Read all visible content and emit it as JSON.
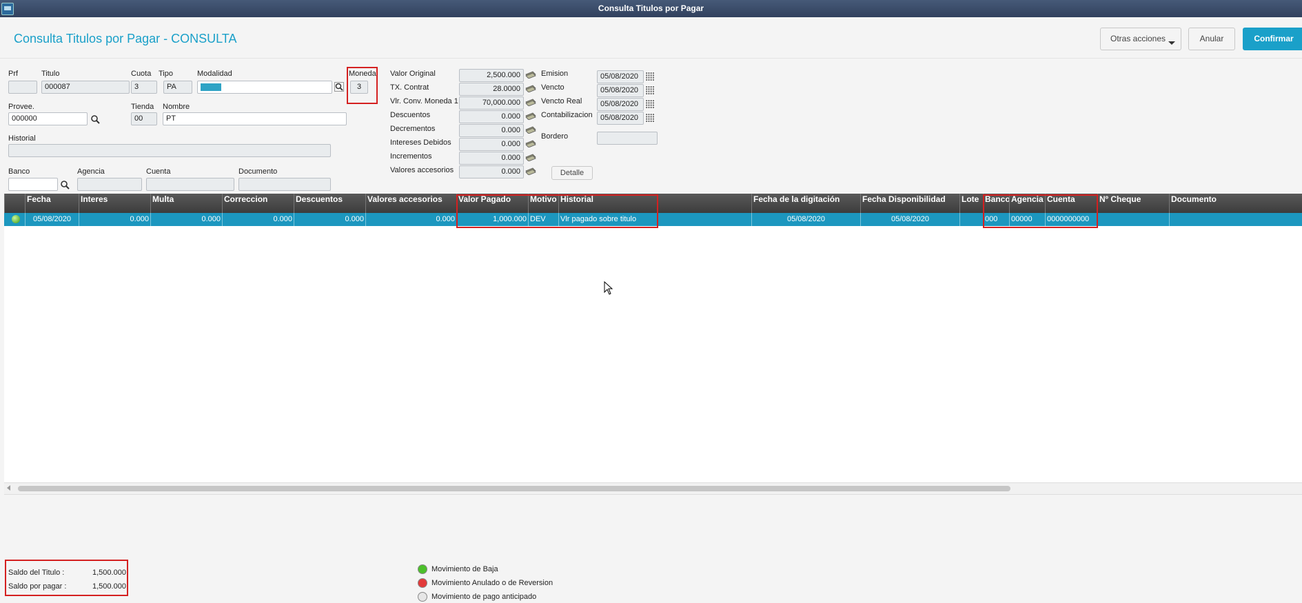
{
  "window": {
    "title": "Consulta Titulos por Pagar"
  },
  "header": {
    "title": "Consulta Titulos por Pagar - CONSULTA",
    "buttons": {
      "otras": "Otras acciones",
      "anular": "Anular",
      "confirmar": "Confirmar"
    }
  },
  "form": {
    "prf": {
      "label": "Prf",
      "value": ""
    },
    "titulo": {
      "label": "Titulo",
      "value": "000087"
    },
    "cuota": {
      "label": "Cuota",
      "value": "3"
    },
    "tipo": {
      "label": "Tipo",
      "value": "PA"
    },
    "modalidad": {
      "label": "Modalidad",
      "value": ""
    },
    "moneda": {
      "label": "Moneda",
      "value": "3"
    },
    "provee": {
      "label": "Provee.",
      "value": "000000"
    },
    "tienda": {
      "label": "Tienda",
      "value": "00"
    },
    "nombre": {
      "label": "Nombre",
      "value": "PT"
    },
    "historial": {
      "label": "Historial",
      "value": ""
    },
    "banco": {
      "label": "Banco",
      "value": ""
    },
    "agencia": {
      "label": "Agencia",
      "value": ""
    },
    "cuenta": {
      "label": "Cuenta",
      "value": ""
    },
    "documento": {
      "label": "Documento",
      "value": ""
    },
    "valores": [
      {
        "label": "Valor Original",
        "value": "2,500.000"
      },
      {
        "label": "TX. Contrat",
        "value": "28.0000"
      },
      {
        "label": "Vlr. Conv. Moneda 1",
        "value": "70,000.000"
      },
      {
        "label": "Descuentos",
        "value": "0.000"
      },
      {
        "label": "Decrementos",
        "value": "0.000"
      },
      {
        "label": "Intereses Debidos",
        "value": "0.000"
      },
      {
        "label": "Incrementos",
        "value": "0.000"
      },
      {
        "label": "Valores accesorios",
        "value": "0.000"
      }
    ],
    "fechas": [
      {
        "label": "Emision",
        "value": "05/08/2020"
      },
      {
        "label": "Vencto",
        "value": "05/08/2020"
      },
      {
        "label": "Vencto Real",
        "value": "05/08/2020"
      },
      {
        "label": "Contabilizacion",
        "value": "05/08/2020"
      }
    ],
    "bordero": {
      "label": "Bordero",
      "value": ""
    },
    "detalle_label": "Detalle"
  },
  "grid": {
    "columns": [
      "Fecha",
      "Interes",
      "Multa",
      "Correccion",
      "Descuentos",
      "Valores accesorios",
      "Valor Pagado",
      "Motivo",
      "Historial",
      "Fecha de la digitación",
      "Fecha Disponibilidad",
      "Lote",
      "Banco",
      "Agencia",
      "Cuenta",
      "Nº Cheque",
      "Documento"
    ],
    "rows": [
      {
        "fecha": "05/08/2020",
        "interes": "0.000",
        "multa": "0.000",
        "correccion": "0.000",
        "descuentos": "0.000",
        "valores_accesorios": "0.000",
        "valor_pagado": "1,000.000",
        "motivo": "DEV",
        "historial": "Vlr pagado sobre titulo",
        "fecha_digitacion": "05/08/2020",
        "fecha_disponibilidad": "05/08/2020",
        "lote": "",
        "banco": "000",
        "agencia": "00000",
        "cuenta": "0000000000",
        "cheque": "",
        "documento": ""
      }
    ]
  },
  "saldos": {
    "titulo_label": "Saldo del Titulo :",
    "titulo_value": "1,500.000",
    "pagar_label": "Saldo por pagar  :",
    "pagar_value": "1,500.000"
  },
  "legend": [
    {
      "label": "Movimiento de Baja",
      "color": "#4cc02a"
    },
    {
      "label": "Movimiento Anulado o de Reversion",
      "color": "#e23a3a"
    },
    {
      "label": "Movimiento de pago anticipado",
      "color": "#e6e6e6"
    }
  ],
  "colors": {
    "accent": "#1aa0c9",
    "highlight": "#d42020"
  }
}
